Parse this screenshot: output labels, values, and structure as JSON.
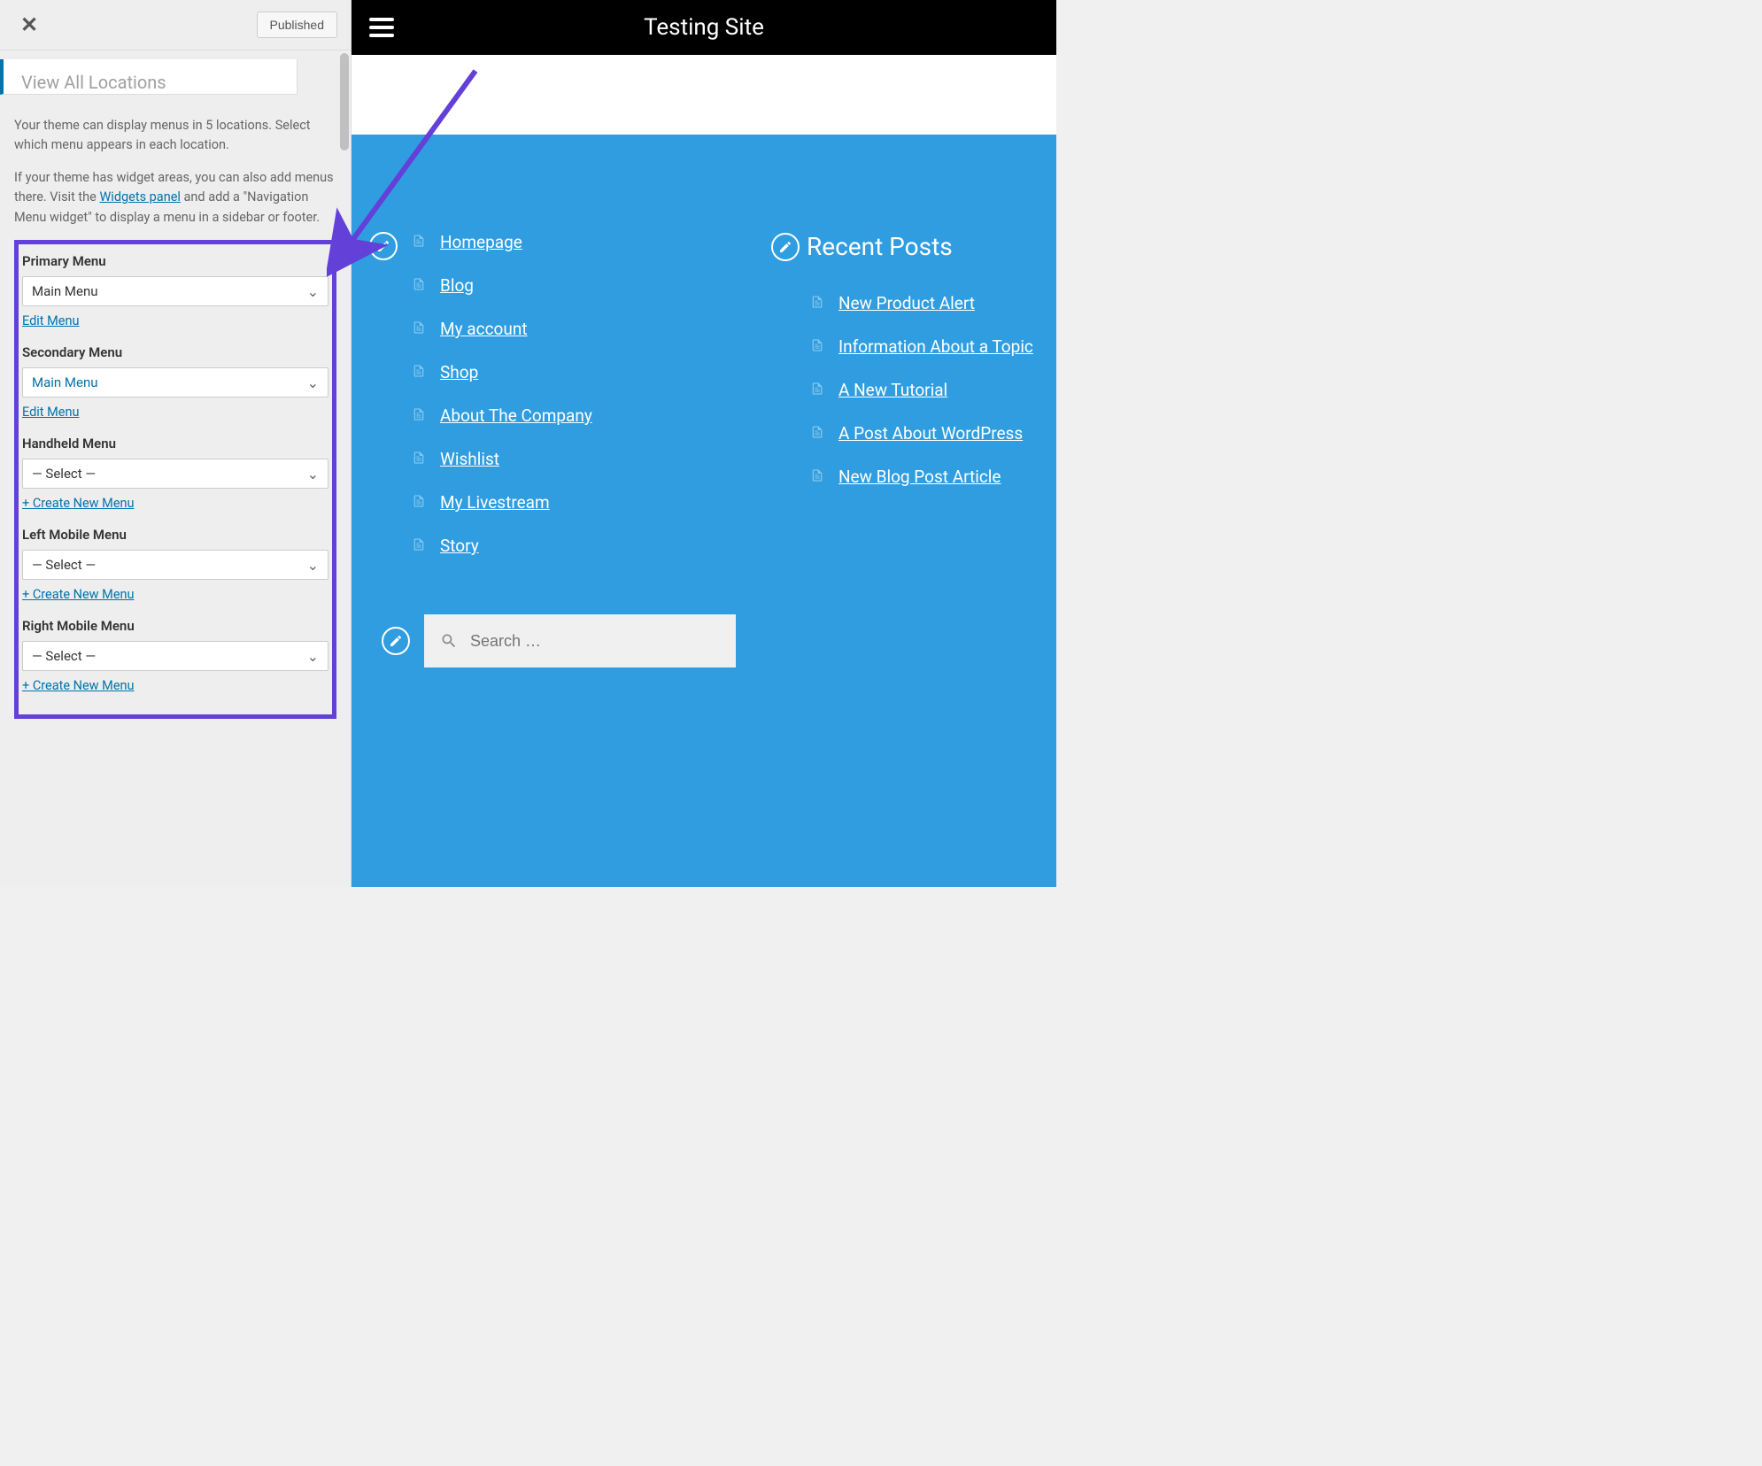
{
  "sidebar": {
    "close_label": "✕",
    "published_label": "Published",
    "panel_partial": "View All Locations",
    "help1": "Your theme can display menus in 5 locations. Select which menu appears in each location.",
    "help2a": "If your theme has widget areas, you can also add menus there. Visit the ",
    "help2_link": "Widgets panel",
    "help2b": " and add a \"Navigation Menu widget\" to display a menu in a sidebar or footer.",
    "locations": [
      {
        "label": "Primary Menu",
        "selected": "Main Menu",
        "selected_blue": false,
        "action": "Edit Menu"
      },
      {
        "label": "Secondary Menu",
        "selected": "Main Menu",
        "selected_blue": true,
        "action": "Edit Menu"
      },
      {
        "label": "Handheld Menu",
        "selected": "— Select —",
        "selected_blue": false,
        "action": "+ Create New Menu"
      },
      {
        "label": "Left Mobile Menu",
        "selected": "— Select —",
        "selected_blue": false,
        "action": "+ Create New Menu"
      },
      {
        "label": "Right Mobile Menu",
        "selected": "— Select —",
        "selected_blue": false,
        "action": "+ Create New Menu"
      }
    ]
  },
  "preview": {
    "site_title": "Testing Site",
    "col1_links": [
      "Homepage",
      "Blog",
      "My account",
      "Shop",
      "About The Company",
      "Wishlist",
      "My Livestream",
      "Story"
    ],
    "col2_title": "Recent Posts",
    "col2_links": [
      "New Product Alert",
      "Information About a Topic",
      "A New Tutorial",
      "A Post About WordPress",
      "New Blog Post Article"
    ],
    "search_placeholder": "Search …"
  }
}
